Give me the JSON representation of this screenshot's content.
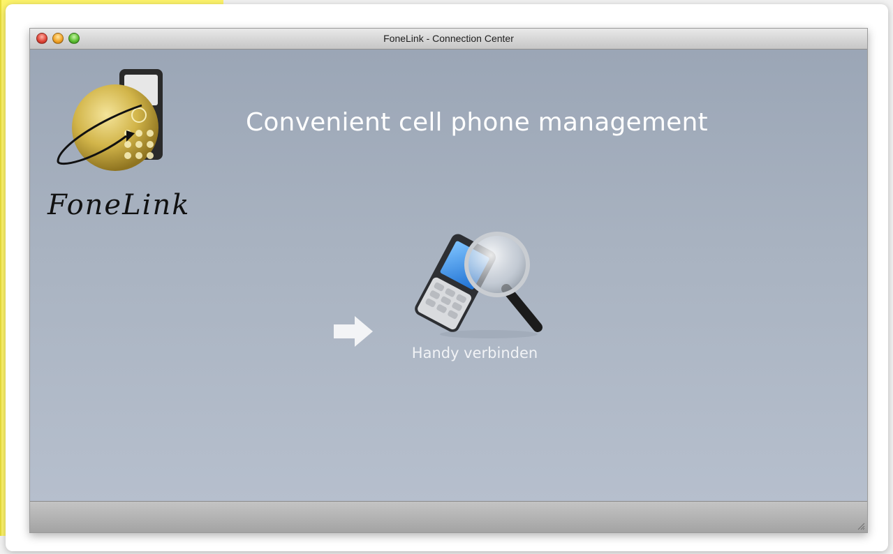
{
  "window": {
    "title": "FoneLink - Connection Center"
  },
  "main": {
    "headline": "Convenient cell phone management",
    "logo_text": "FoneLink",
    "connect_label": "Handy verbinden"
  },
  "icons": {
    "window_controls": [
      "close-icon",
      "minimize-icon",
      "zoom-icon"
    ],
    "logo": "fonelink-logo",
    "arrow": "arrow-right-icon",
    "connect": "phone-search-icon",
    "resize": "resize-grip-icon"
  },
  "colors": {
    "content_top": "#9ba6b6",
    "content_bottom": "#b6bfcd",
    "headline": "#ffffff",
    "logo_globe": "#d9c25a",
    "backdrop": "#fdf46b"
  }
}
